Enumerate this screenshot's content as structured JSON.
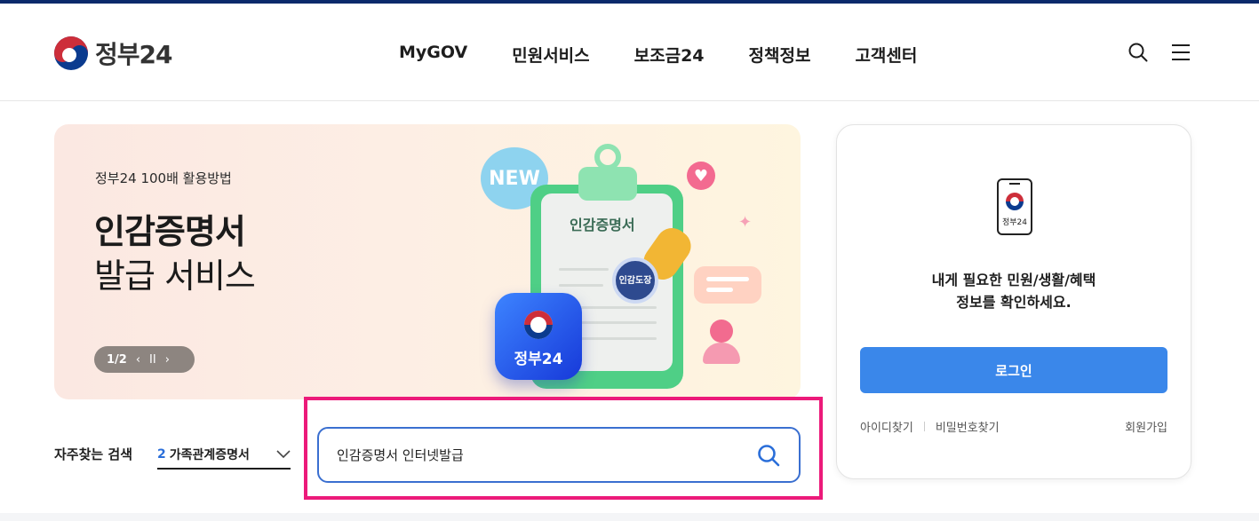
{
  "brand": {
    "logo_text": "정부24"
  },
  "nav": {
    "items": [
      "MyGOV",
      "민원서비스",
      "보조금24",
      "정책정보",
      "고객센터"
    ]
  },
  "header_icons": {
    "search": "search-icon",
    "menu": "menu-icon"
  },
  "banner": {
    "eyebrow": "정부24 100배 활용방법",
    "title_line1": "인감증명서",
    "title_line2": "발급 서비스",
    "pager": {
      "count": "1/2",
      "prev": "‹",
      "pause": "II",
      "next": "›"
    },
    "illustration": {
      "new_badge": "NEW",
      "paper_title": "인감증명서",
      "stamp_text": "인감도장",
      "app_tile_label": "정부24"
    }
  },
  "login": {
    "phone_label": "정부24",
    "message_line1": "내게 필요한 민원/생활/혜택",
    "message_line2": "정보를 확인하세요.",
    "button": "로그인",
    "find_id": "아이디찾기",
    "find_pw": "비밀번호찾기",
    "signup": "회원가입"
  },
  "search": {
    "faq_label": "자주찾는 검색",
    "faq_selected_rank": "2",
    "faq_selected_text": "가족관계증명서",
    "query": "인감증명서 인터넷발급"
  },
  "colors": {
    "accent": "#3a87ea",
    "highlight": "#ec1a7a",
    "search_border": "#3a6fd0",
    "top_bar": "#0b2a6b"
  }
}
